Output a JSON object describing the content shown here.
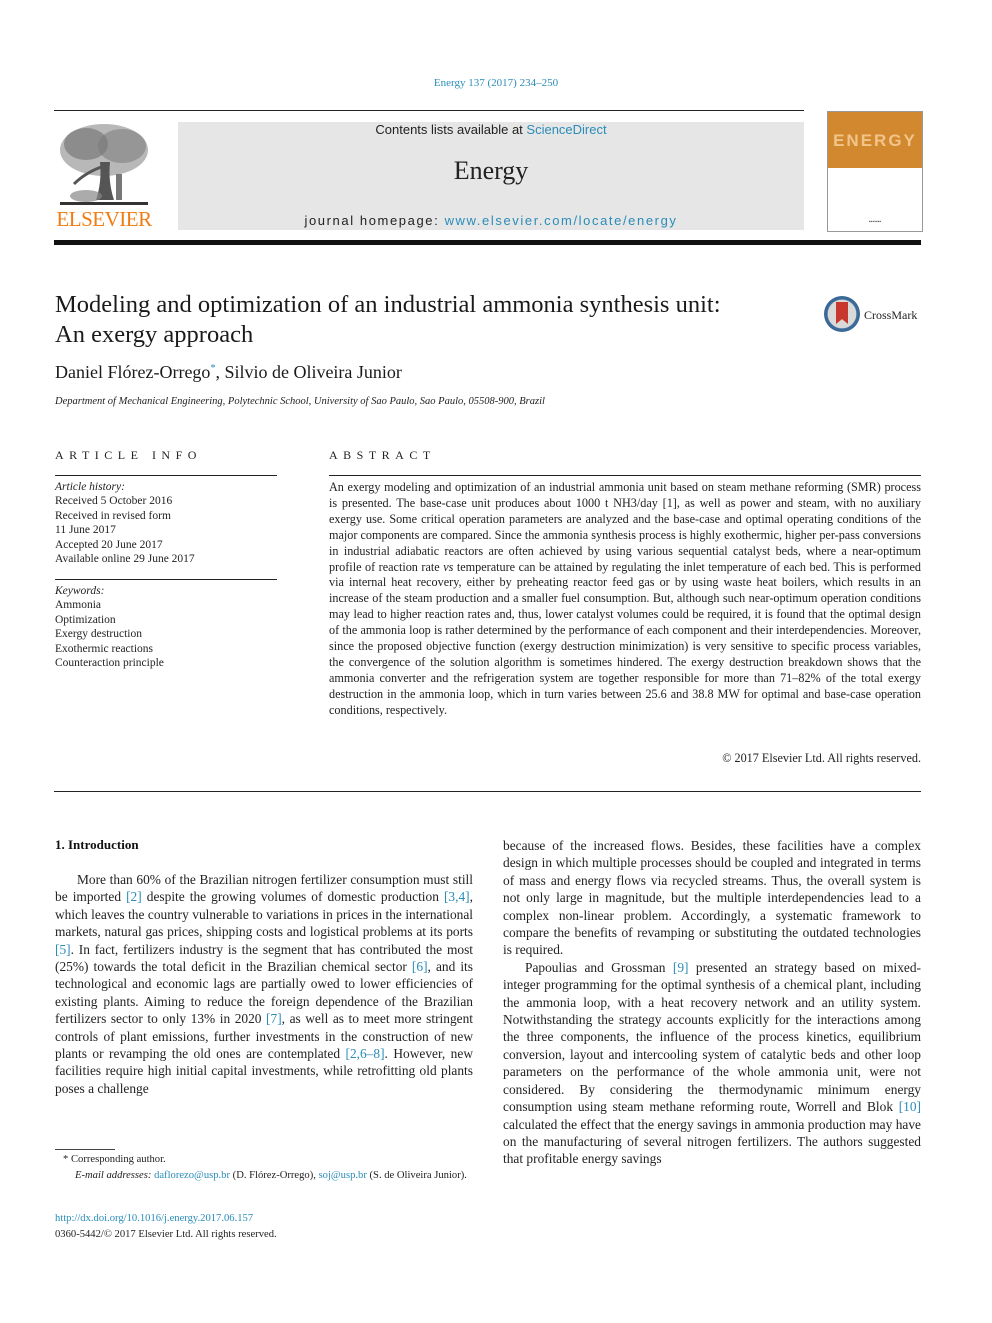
{
  "header": {
    "citation": "Energy 137 (2017) 234–250",
    "publisher_logo_text": "ELSEVIER",
    "contents_prefix": "Contents lists available at ",
    "contents_link": "ScienceDirect",
    "journal_name": "Energy",
    "homepage_prefix": "journal homepage: ",
    "homepage_link": "www.elsevier.com/locate/energy",
    "cover_title": "ENERGY",
    "colors": {
      "link": "#2a8cb8",
      "elsevier_orange": "#f07c12",
      "cover_orange": "#d2882e",
      "masthead_gray": "#e6e6e6"
    }
  },
  "article": {
    "title_line1": "Modeling and optimization of an industrial ammonia synthesis unit:",
    "title_line2": "An exergy approach",
    "crossmark_label": "CrossMark",
    "author1": "Daniel Flórez-Orrego",
    "author1_mark": "*",
    "author_sep": ", ",
    "author2": "Silvio de Oliveira Junior",
    "affiliation": "Department of Mechanical Engineering, Polytechnic School, University of Sao Paulo, Sao Paulo, 05508-900, Brazil"
  },
  "article_info": {
    "heading": "ARTICLE INFO",
    "history_label": "Article history:",
    "history": [
      "Received 5 October 2016",
      "Received in revised form",
      "11 June 2017",
      "Accepted 20 June 2017",
      "Available online 29 June 2017"
    ],
    "keywords_label": "Keywords:",
    "keywords": [
      "Ammonia",
      "Optimization",
      "Exergy destruction",
      "Exothermic reactions",
      "Counteraction principle"
    ]
  },
  "abstract": {
    "heading": "ABSTRACT",
    "part1": "An exergy modeling and optimization of an industrial ammonia unit based on steam methane reforming (SMR) process is presented. The base-case unit produces about 1000 t NH3/day [1], as well as power and steam, with no auxiliary exergy use. Some critical operation parameters are analyzed and the base-case and optimal operating conditions of the major components are compared. Since the ammonia synthesis process is highly exothermic, higher per-pass conversions in industrial adiabatic reactors are often achieved by using various sequential catalyst beds, where a near-optimum profile of reaction rate ",
    "vs": "vs",
    "part2": " temperature can be attained by regulating the inlet temperature of each bed. This is performed via internal heat recovery, either by preheating reactor feed gas or by using waste heat boilers, which results in an increase of the steam production and a smaller fuel consumption. But, although such near-optimum operation conditions may lead to higher reaction rates and, thus, lower catalyst volumes could be required, it is found that the optimal design of the ammonia loop is rather determined by the performance of each component and their interdependencies. Moreover, since the proposed objective function (exergy destruction minimization) is very sensitive to specific process variables, the convergence of the solution algorithm is sometimes hindered. The exergy destruction breakdown shows that the ammonia converter and the refrigeration system are together responsible for more than 71–82% of the total exergy destruction in the ammonia loop, which in turn varies between 25.6 and 38.8 MW for optimal and base-case operation conditions, respectively.",
    "copyright": "© 2017 Elsevier Ltd. All rights reserved."
  },
  "intro": {
    "heading": "1.  Introduction",
    "left_segments": [
      {
        "t": "More than 60% of the Brazilian nitrogen fertilizer consumption must still be imported "
      },
      {
        "ref": "[2]"
      },
      {
        "t": " despite the growing volumes of domestic production "
      },
      {
        "ref": "[3,4]"
      },
      {
        "t": ", which leaves the country vulnerable to variations in prices in the international markets, natural gas prices, shipping costs and logistical problems at its ports "
      },
      {
        "ref": "[5]"
      },
      {
        "t": ". In fact, fertilizers industry is the segment that has contributed the most (25%) towards the total deficit in the Brazilian chemical sector "
      },
      {
        "ref": "[6]"
      },
      {
        "t": ", and its technological and economic lags are partially owed to lower efficiencies of existing plants. Aiming to reduce the foreign dependence of the Brazilian fertilizers sector to only 13% in 2020 "
      },
      {
        "ref": "[7]"
      },
      {
        "t": ", as well as to meet more stringent controls of plant emissions, further investments in the construction of new plants or revamping the old ones are contemplated "
      },
      {
        "ref": "[2,6–8]"
      },
      {
        "t": ". However, new facilities require high initial capital investments, while retrofitting old plants poses a challenge"
      }
    ],
    "right_p1": "because of the increased flows. Besides, these facilities have a complex design in which multiple processes should be coupled and integrated in terms of mass and energy flows via recycled streams. Thus, the overall system is not only large in magnitude, but the multiple interdependencies lead to a complex non-linear problem. Accordingly, a systematic framework to compare the benefits of revamping or substituting the outdated technologies is required.",
    "right_p2_segments": [
      {
        "t": "Papoulias and Grossman "
      },
      {
        "ref": "[9]"
      },
      {
        "t": " presented an strategy based on mixed-integer programming for the optimal synthesis of a chemical plant, including the ammonia loop, with a heat recovery network and an utility system. Notwithstanding the strategy accounts explicitly for the interactions among the three components, the influence of the process kinetics, equilibrium conversion, layout and intercooling system of catalytic beds and other loop parameters on the performance of the whole ammonia unit, were not considered. By considering the thermodynamic minimum energy consumption using steam methane reforming route, Worrell and Blok "
      },
      {
        "ref": "[10]"
      },
      {
        "t": " calculated the effect that the energy savings in ammonia production may have on the manufacturing of several nitrogen fertilizers. The authors suggested that profitable energy savings"
      }
    ]
  },
  "footnote": {
    "mark": "* ",
    "corresponding": "Corresponding author.",
    "email_label": "E-mail addresses: ",
    "email1": "daflorezo@usp.br",
    "email1_name": " (D. Flórez-Orrego), ",
    "email2": "soj@usp.br",
    "email2_name": " (S. de Oliveira Junior)."
  },
  "doi": {
    "link": "http://dx.doi.org/10.1016/j.energy.2017.06.157",
    "issn_line": "0360-5442/© 2017 Elsevier Ltd. All rights reserved."
  }
}
